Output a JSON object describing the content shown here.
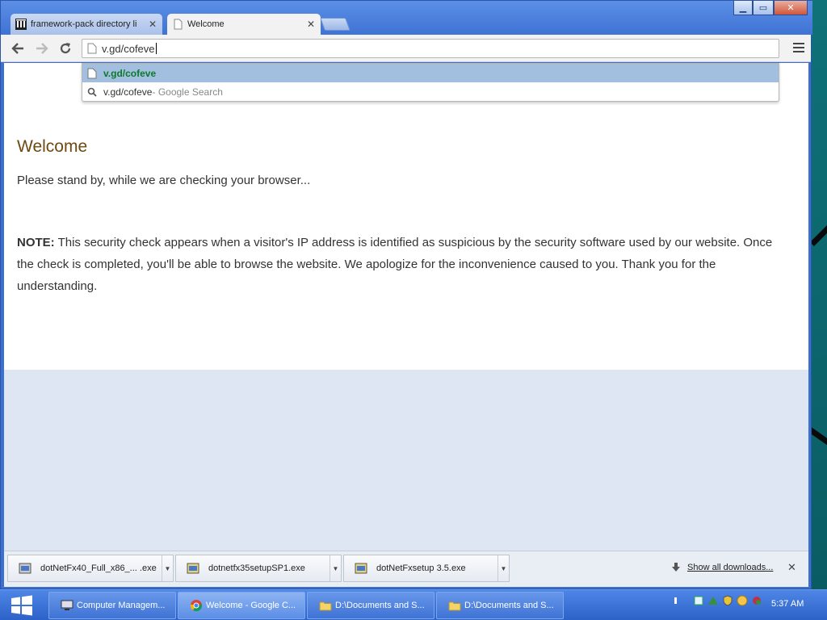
{
  "browser": {
    "tabs": [
      {
        "title": "framework-pack directory li",
        "active": false
      },
      {
        "title": "Welcome",
        "active": true
      }
    ],
    "window_controls": {
      "minimize": "▁",
      "maximize": "▭",
      "close": "✕"
    },
    "address": {
      "value": "v.gd/cofeve"
    },
    "suggestions": [
      {
        "text": "v.gd/cofeve",
        "suffix": "",
        "icon": "page-icon",
        "selected": true
      },
      {
        "text": "v.gd/cofeve",
        "suffix": " - Google Search",
        "icon": "search-icon",
        "selected": false
      }
    ]
  },
  "page": {
    "heading": "Welcome",
    "standby": "Please stand by, while we are checking your browser...",
    "note_label": "NOTE:",
    "note_text": " This security check appears when a visitor's IP address is identified as suspicious by the security software used by our website. Once the check is completed, you'll be able to browse the website. We apologize for the inconvenience caused to you. Thank you for the understanding."
  },
  "downloads": {
    "items": [
      {
        "name": "dotNetFx40_Full_x86_... .exe"
      },
      {
        "name": "dotnetfx35setupSP1.exe"
      },
      {
        "name": "dotNetFxsetup 3.5.exe"
      }
    ],
    "show_all": "Show all downloads...",
    "close": "✕"
  },
  "taskbar": {
    "tasks": [
      {
        "label": "Computer Managem...",
        "active": false
      },
      {
        "label": "Welcome - Google C...",
        "active": true
      },
      {
        "label": "D:\\Documents and S...",
        "active": false
      },
      {
        "label": "D:\\Documents and S...",
        "active": false
      }
    ],
    "clock": "5:37 AM"
  },
  "colors": {
    "heading": "#6e4a10",
    "suggestion_highlight": "#a3bfe0",
    "suggestion_url": "#0a7a2a",
    "lower_page": "#dfe6f3",
    "taskbar": "#2d62c8"
  }
}
